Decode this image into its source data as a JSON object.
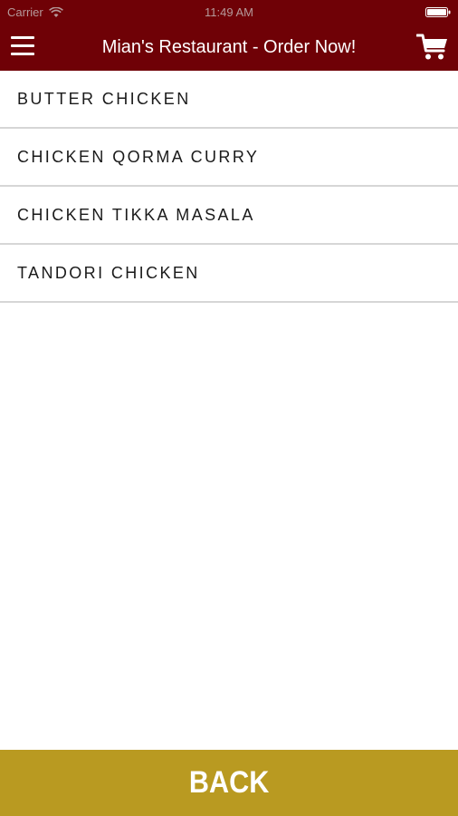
{
  "status_bar": {
    "carrier": "Carrier",
    "time": "11:49 AM",
    "wifi_icon": "wifi-icon",
    "battery_icon": "battery-icon"
  },
  "header": {
    "title": "Mian's Restaurant - Order Now!",
    "menu_icon": "hamburger-menu-icon",
    "cart_icon": "shopping-cart-icon"
  },
  "menu": {
    "items": [
      {
        "label": "BUTTER CHICKEN"
      },
      {
        "label": "CHICKEN QORMA CURRY"
      },
      {
        "label": "CHICKEN TIKKA MASALA"
      },
      {
        "label": "TANDORI CHICKEN"
      }
    ]
  },
  "footer": {
    "back_label": "BACK"
  },
  "colors": {
    "header_bg": "#6f0106",
    "back_button_bg": "#b99a21",
    "divider": "#d6d6d6"
  }
}
